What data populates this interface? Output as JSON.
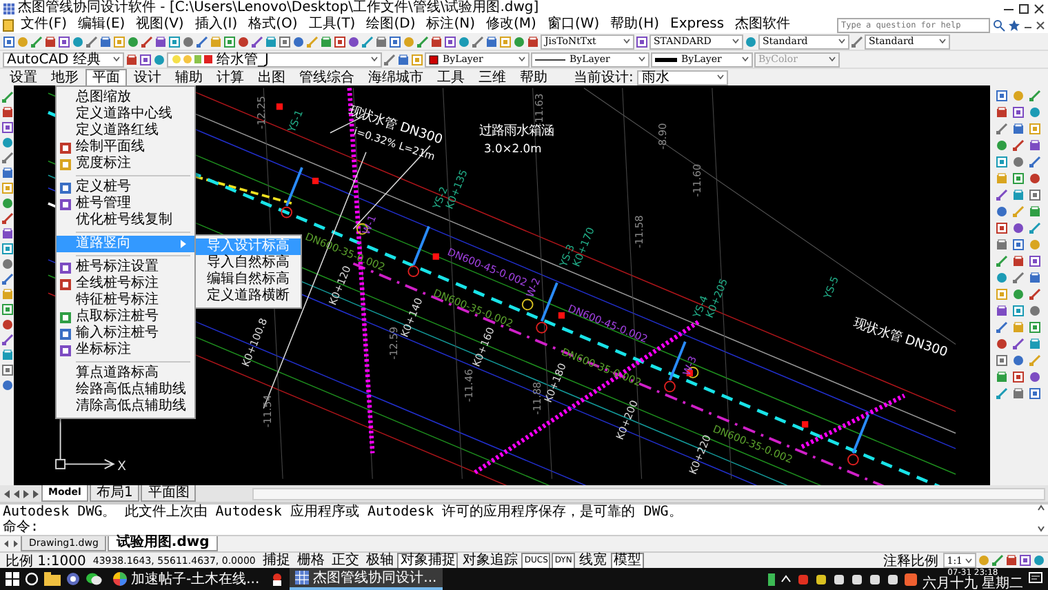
{
  "window": {
    "title": "杰图管线协同设计软件 - [C:\\Users\\Lenovo\\Desktop\\工作文件\\管线\\试验用图.dwg]"
  },
  "menu_bar": [
    "文件(F)",
    "编辑(E)",
    "视图(V)",
    "插入(I)",
    "格式(O)",
    "工具(T)",
    "绘图(D)",
    "标注(N)",
    "修改(M)",
    "窗口(W)",
    "帮助(H)",
    "Express",
    "杰图软件"
  ],
  "help_search": {
    "placeholder": "Type a question for help"
  },
  "toolbar_dropdowns": [
    {
      "value": "JisToNtTxt"
    },
    {
      "value": "STANDARD"
    },
    {
      "value": "Standard"
    },
    {
      "value": "Standard"
    }
  ],
  "properties_bar": [
    {
      "kind": "workspace",
      "value": "AutoCAD 经典",
      "disabled": false
    },
    {
      "kind": "layer",
      "value": "给水管_J",
      "disabled": false
    },
    {
      "kind": "color",
      "value": "ByLayer",
      "disabled": false
    },
    {
      "kind": "linetype",
      "value": "ByLayer",
      "disabled": false
    },
    {
      "kind": "lineweight",
      "value": "ByLayer",
      "disabled": false
    },
    {
      "kind": "plot_style",
      "value": "ByColor",
      "disabled": true
    }
  ],
  "ribbon_tabs": [
    {
      "label": "设置",
      "selected": false
    },
    {
      "label": "地形",
      "selected": false
    },
    {
      "label": "平面",
      "selected": true
    },
    {
      "label": "设计",
      "selected": false
    },
    {
      "label": "辅助",
      "selected": false
    },
    {
      "label": "计算",
      "selected": false
    },
    {
      "label": "出图",
      "selected": false
    },
    {
      "label": "管线综合",
      "selected": false
    },
    {
      "label": "海绵城市",
      "selected": false
    },
    {
      "label": "工具",
      "selected": false
    },
    {
      "label": "三维",
      "selected": false
    },
    {
      "label": "帮助",
      "selected": false
    }
  ],
  "current_design": {
    "label": "当前设计:",
    "value": "雨水"
  },
  "plane_menu": {
    "items": [
      {
        "kind": "item",
        "label": "总图缩放",
        "selected": false
      },
      {
        "kind": "item",
        "label": "定义道路中心线",
        "selected": false
      },
      {
        "kind": "item",
        "label": "定义道路红线",
        "selected": false
      },
      {
        "kind": "icon_item",
        "label": "绘制平面线",
        "selected": false
      },
      {
        "kind": "icon_item",
        "label": "宽度标注",
        "selected": false
      },
      {
        "kind": "separator"
      },
      {
        "kind": "icon_item",
        "label": "定义桩号",
        "selected": false
      },
      {
        "kind": "icon_item",
        "label": "桩号管理",
        "selected": false
      },
      {
        "kind": "item",
        "label": "优化桩号线复制",
        "selected": false
      },
      {
        "kind": "separator"
      },
      {
        "kind": "submenu",
        "label": "道路竖向",
        "selected": true
      },
      {
        "kind": "separator"
      },
      {
        "kind": "icon_item",
        "label": "桩号标注设置",
        "selected": false
      },
      {
        "kind": "icon_item",
        "label": "全线桩号标注",
        "selected": false
      },
      {
        "kind": "item",
        "label": "特征桩号标注",
        "selected": false
      },
      {
        "kind": "icon_item",
        "label": "点取标注桩号",
        "selected": false
      },
      {
        "kind": "icon_item",
        "label": "输入标注桩号",
        "selected": false
      },
      {
        "kind": "icon_item",
        "label": "坐标标注",
        "selected": false
      },
      {
        "kind": "separator"
      },
      {
        "kind": "item",
        "label": "算点道路标高",
        "selected": false
      },
      {
        "kind": "item",
        "label": "绘路高低点辅助线",
        "selected": false
      },
      {
        "kind": "item",
        "label": "清除高低点辅助线",
        "selected": false
      }
    ]
  },
  "submenu": {
    "items": [
      {
        "label": "导入设计标高",
        "selected": true
      },
      {
        "label": "导入自然标高",
        "selected": false
      },
      {
        "label": "编辑自然标高",
        "selected": false
      },
      {
        "label": "定义道路横断",
        "selected": false
      }
    ]
  },
  "drawing": {
    "labels": [
      "现状水管 DN300",
      "i=0.32% L=21m",
      "过路雨水箱涵",
      "3.0×2.0m",
      "YS-1",
      "K0+100.8",
      "YS-2",
      "K0+135",
      "YS-3",
      "K0+170",
      "YS-4",
      "K0+205",
      "W-1",
      "W-2",
      "W-3",
      "DN600-35-0.002",
      "DN600-35-0.002",
      "DN600-35-0.002",
      "DN600-45-0.002",
      "DN600-45-0.002",
      "K0+120",
      "K0+140",
      "K0+160",
      "K0+180",
      "K0+200",
      "K0+220",
      "-12.25",
      "-11.63",
      "-8.90",
      "-11.60",
      "-11.58",
      "-11.46",
      "-11.88",
      "-12.59",
      "-11.54",
      "YS-5",
      "现状水管 DN300",
      "DN600-35-0.002"
    ],
    "axes": {
      "x": "X"
    }
  },
  "layout_tabs": [
    {
      "label": "Model",
      "selected": true
    },
    {
      "label": "布局1",
      "selected": false
    },
    {
      "label": "平面图",
      "selected": false
    }
  ],
  "command_line": {
    "history": "Autodesk DWG。  此文件上次由 Autodesk 应用程序或 Autodesk 许可的应用程序保存，是可靠的 DWG。",
    "prompt": "命令:"
  },
  "document_tabs": [
    {
      "label": "Drawing1.dwg",
      "selected": false
    },
    {
      "label": "试验用图.dwg",
      "selected": true
    }
  ],
  "status_bar": {
    "scale": "比例 1:1000",
    "coordinates": "43938.1643, 55611.4637, 0.0000",
    "toggles": [
      {
        "label": "捕捉",
        "on": false
      },
      {
        "label": "栅格",
        "on": false
      },
      {
        "label": "正交",
        "on": false
      },
      {
        "label": "极轴",
        "on": false
      },
      {
        "label": "对象捕捉",
        "on": true
      },
      {
        "label": "对象追踪",
        "on": false
      },
      {
        "label": "DUCS",
        "on": true
      },
      {
        "label": "DYN",
        "on": true
      },
      {
        "label": "线宽",
        "on": false
      },
      {
        "label": "模型",
        "on": true
      }
    ],
    "annotation_scale_label": "注释比例",
    "annotation_scale": "1:1"
  },
  "taskbar": {
    "apps": [
      {
        "label": "加速帖子-土木在线...",
        "active": false
      },
      {
        "label": "杰图管线协同设计...",
        "active": true
      }
    ],
    "time": "07-31 23:18",
    "date": "六月十九 星期二"
  }
}
